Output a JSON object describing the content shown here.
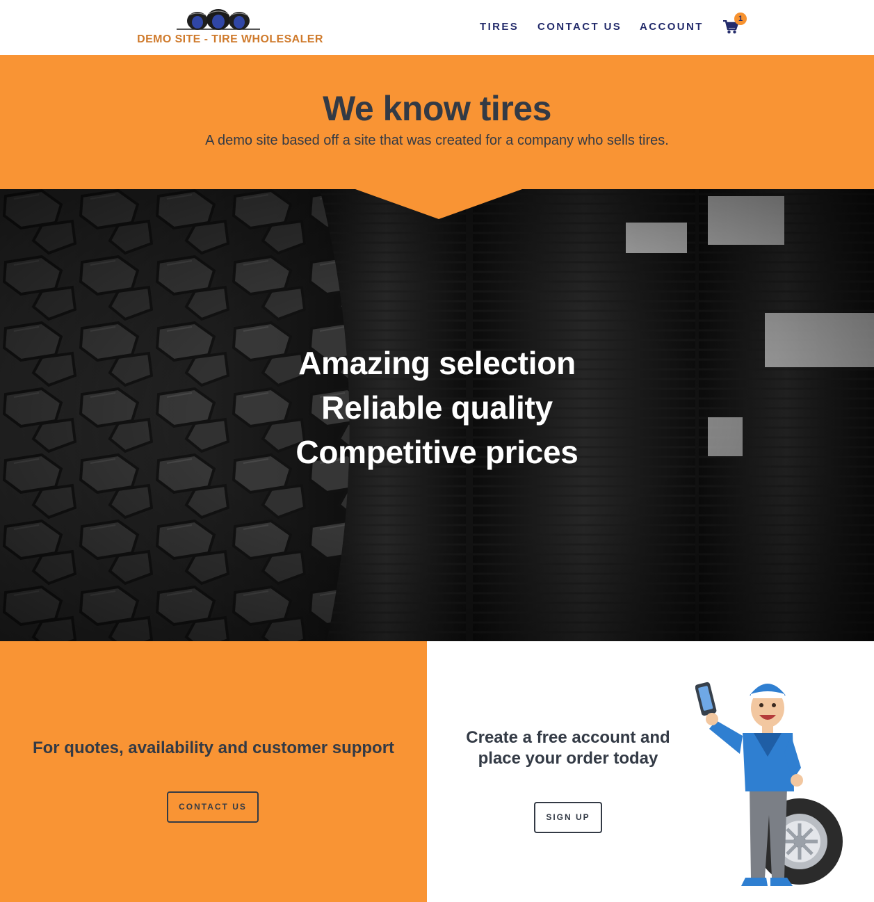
{
  "header": {
    "logo_text": "DEMO SITE - TIRE WHOLESALER",
    "nav": [
      {
        "label": "TIRES"
      },
      {
        "label": "CONTACT US"
      },
      {
        "label": "ACCOUNT"
      }
    ],
    "cart_icon": "shopping-cart-icon",
    "cart_count": "1"
  },
  "hero": {
    "title": "We know tires",
    "subtitle": "A demo site based off a site that was created for a company who sells tires."
  },
  "banner": {
    "taglines": [
      "Amazing selection",
      "Reliable quality",
      "Competitive prices"
    ]
  },
  "panel_left": {
    "heading": "For quotes, availability and customer support",
    "button_label": "CONTACT US"
  },
  "panel_right": {
    "heading": "Create a free account and place your order today",
    "button_label": "SIGN UP"
  },
  "colors": {
    "accent_orange": "#f99434",
    "nav_navy": "#232b6b",
    "logo_orange": "#cf7a2b",
    "text_dark": "#333a45"
  }
}
